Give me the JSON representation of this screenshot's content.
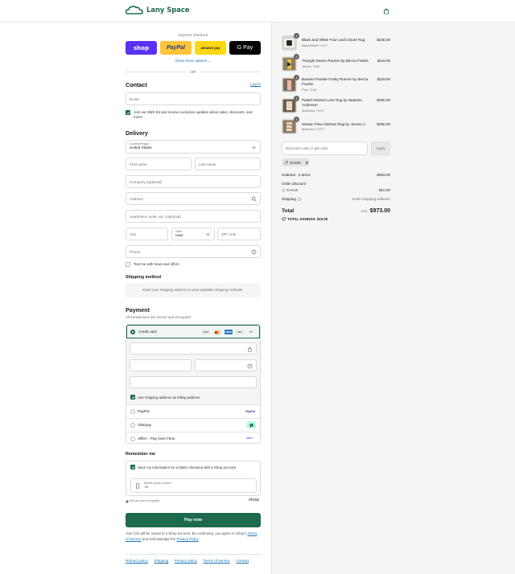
{
  "header": {
    "brand": "Lany Space"
  },
  "express": {
    "title": "Express checkout",
    "shop_label": "shop",
    "paypal_label": "PayPal",
    "amazon_label": "amazon pay",
    "gpay_label": "G Pay",
    "more_options": "Show more options ⌄",
    "or_label": "OR"
  },
  "contact": {
    "title": "Contact",
    "login_link": "Log in",
    "email_placeholder": "Email",
    "sms_label": "Join our SMS list and receive exclusive updates about sales, discounts, and more!"
  },
  "delivery": {
    "title": "Delivery",
    "country_label": "Country/Region",
    "country_value": "United States",
    "first_name": "First name",
    "last_name": "Last name",
    "company": "Company (optional)",
    "address": "Address",
    "apartment": "Apartment, suite, etc. (optional)",
    "city": "City",
    "state_label": "State",
    "state_value": "Iowa",
    "zip": "ZIP code",
    "phone": "Phone",
    "news_label": "Text me with news and offers"
  },
  "shipping_method": {
    "title": "Shipping method",
    "note": "Enter your shipping address to view available shipping methods."
  },
  "payment": {
    "title": "Payment",
    "subtitle": "All transactions are secure and encrypted.",
    "credit_card": "Credit card",
    "more_cards": "+5",
    "billing_label": "Use shipping address as billing address",
    "paypal": "PayPal",
    "afterpay": "Afterpay",
    "affirm": "Affirm - Pay Over Time",
    "paypal_logo": "PayPal",
    "affirm_logo": "affirm"
  },
  "remember": {
    "title": "Remember me",
    "save_label": "Save my information for a faster checkout with a Shop account",
    "phone_label": "Mobile phone number",
    "phone_value": "+1",
    "secure": "Secure and encrypted",
    "shop_brand": "shop"
  },
  "pay_button": "Pay now",
  "legal": {
    "line1": "Your info will be saved to a Shop account. By continuing, you agree to Shop's",
    "terms": "Terms of Service",
    "middle": "and acknowledge the",
    "privacy": "Privacy Policy",
    "end": "."
  },
  "footer": {
    "refund": "Refund policy",
    "shipping": "Shipping",
    "privacy": "Privacy policy",
    "terms": "Terms of service",
    "contact": "Contact"
  },
  "cart": {
    "items": [
      {
        "name": "Black and White Four Leaf Clover Rug",
        "variant": "Black/White / 5'X7'",
        "price": "$235.00",
        "qty": "1"
      },
      {
        "name": "Triangle Dance Runner by Becca Franks",
        "variant": "Yellow / 3'x8'",
        "price": "$119.00",
        "qty": "1"
      },
      {
        "name": "Banana Parade Funky Runner by Becca Franks",
        "variant": "Pink / 3'x8'",
        "price": "$119.00",
        "qty": "1"
      },
      {
        "name": "Pastel Abstract Line Rug by Natasha Anderson",
        "variant": "Multicolor / 5'X7'",
        "price": "$255.00",
        "qty": "1"
      },
      {
        "name": "Mosaic Flow Abstract Rug by Jonnie Li",
        "variant": "Multicolor / 5'X7'",
        "price": "$255.00",
        "qty": "1"
      }
    ],
    "discount_placeholder": "Discount code or gift card",
    "apply": "Apply",
    "code_tag": "SAS30",
    "subtotal_label": "Subtotal · 5 items",
    "subtotal_value": "$983.00",
    "order_discount_label": "Order discount",
    "order_discount_code": "SAS30",
    "order_discount_value": "- $10.00",
    "shipping_label": "Shipping",
    "shipping_value": "Enter shipping address",
    "total_label": "Total",
    "currency": "USD",
    "total_value": "$973.00",
    "savings_label": "TOTAL SAVINGS",
    "savings_value": "$10.00"
  },
  "colors": {
    "brand_green": "#1d6b4d",
    "shop_purple": "#5a31f4",
    "paypal_yellow": "#ffc439",
    "link_blue": "#1773b0"
  }
}
